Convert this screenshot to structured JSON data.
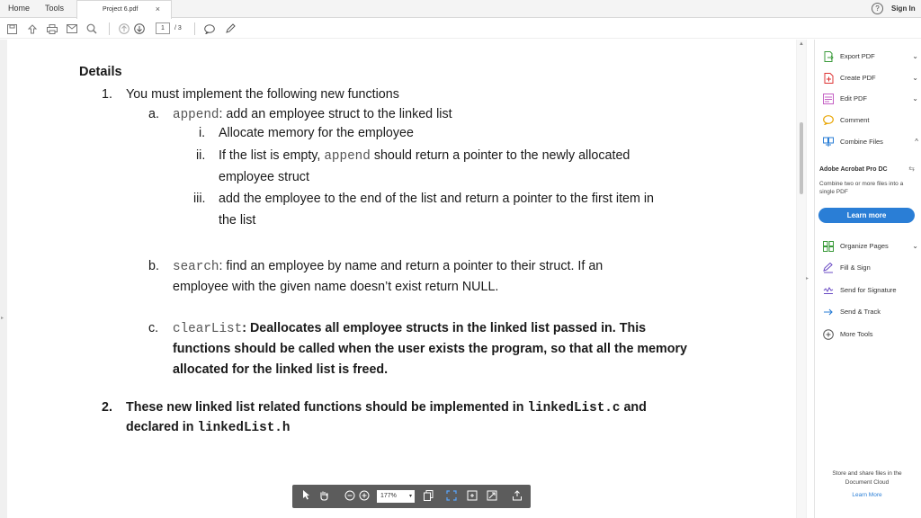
{
  "tabs": {
    "home": "Home",
    "tools": "Tools",
    "document": "Project 6.pdf",
    "close": "×"
  },
  "header": {
    "help": "?",
    "sign_in": "Sign In"
  },
  "toolbar": {
    "icons": [
      "save-icon",
      "upload-icon",
      "print-icon",
      "email-icon",
      "search-icon",
      "page-up-icon",
      "page-down-icon",
      "comment-icon",
      "pen-icon"
    ],
    "current_page": "1",
    "total_pages": "/ 3"
  },
  "document": {
    "heading": "Details",
    "item1": {
      "num": "1.",
      "text": "You must implement the following new functions",
      "a": {
        "letter": "a.",
        "code": "append",
        "text": ": add an employee struct to the linked list",
        "i": {
          "num": "i.",
          "text": "Allocate memory for the employee"
        },
        "ii": {
          "num": "ii.",
          "text_before": "If the list is empty,",
          "code": "append",
          "text_after": "should return a pointer to the newly allocated",
          "cont": "employee struct"
        },
        "iii": {
          "num": "iii.",
          "text": "add the employee to the end of the list and return a pointer to the first item in",
          "cont": "the list"
        }
      },
      "b": {
        "letter": "b.",
        "code": "search",
        "text": ": find an employee by name and return a pointer to their struct. If an",
        "cont": "employee with the given name doesn’t exist return NULL."
      },
      "c": {
        "letter": "c.",
        "code": "clearList",
        "text": ": Deallocates all employee structs in the linked list passed in.  This",
        "cont1": "functions should be called when the user exists the program, so that all the memory",
        "cont2": "allocated for the linked list is freed."
      }
    },
    "item2": {
      "num": "2.",
      "text_before": "These new linked list related functions should be implemented in",
      "code1": "linkedList.c",
      "text_mid": "and",
      "line2_before": "declared in",
      "code2": "linkedList.h"
    }
  },
  "floating_toolbar": {
    "zoom": "177%"
  },
  "right_panel": {
    "tools": [
      {
        "label": "Export PDF",
        "icon": "export-pdf-icon",
        "color": "#3a9a3a",
        "chevron": "⌄"
      },
      {
        "label": "Create PDF",
        "icon": "create-pdf-icon",
        "color": "#d33",
        "chevron": "⌄"
      },
      {
        "label": "Edit PDF",
        "icon": "edit-pdf-icon",
        "color": "#c35ec3",
        "chevron": "⌄"
      },
      {
        "label": "Comment",
        "icon": "comment-icon",
        "color": "#e8a400",
        "chevron": ""
      },
      {
        "label": "Combine Files",
        "icon": "combine-files-icon",
        "color": "#2a7ed6",
        "chevron": "^"
      }
    ],
    "promo": {
      "title": "Adobe Acrobat Pro DC",
      "desc": "Combine two or more files into a single PDF",
      "button": "Learn more"
    },
    "tools2": [
      {
        "label": "Organize Pages",
        "icon": "organize-pages-icon",
        "color": "#3a9a3a",
        "chevron": "⌄"
      },
      {
        "label": "Fill & Sign",
        "icon": "fill-sign-icon",
        "color": "#6a4bc4",
        "chevron": ""
      },
      {
        "label": "Send for Signature",
        "icon": "send-signature-icon",
        "color": "#6a4bc4",
        "chevron": ""
      },
      {
        "label": "Send & Track",
        "icon": "send-track-icon",
        "color": "#2a7ed6",
        "chevron": ""
      },
      {
        "label": "More Tools",
        "icon": "more-tools-icon",
        "color": "#555",
        "chevron": ""
      }
    ],
    "cloud": {
      "text": "Store and share files in the Document Cloud",
      "link": "Learn More"
    }
  }
}
